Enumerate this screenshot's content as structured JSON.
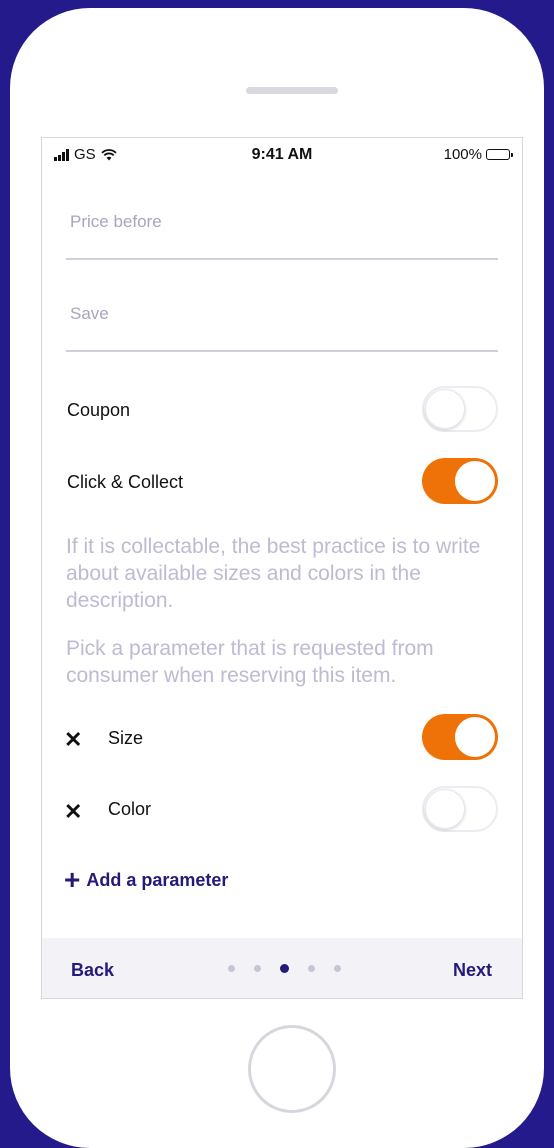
{
  "status_bar": {
    "carrier": "GS",
    "time": "9:41 AM",
    "battery": "100%"
  },
  "form": {
    "price_before": {
      "placeholder": "Price before",
      "value": ""
    },
    "save": {
      "placeholder": "Save",
      "value": ""
    },
    "coupon": {
      "label": "Coupon",
      "enabled": false
    },
    "click_collect": {
      "label": "Click & Collect",
      "enabled": true
    },
    "hint_collectable": "If it is collectable, the best practice is to write about available sizes and colors in the description.",
    "hint_parameter": "Pick a parameter that is requested from consumer when reserving this item.",
    "parameters": [
      {
        "label": "Size",
        "enabled": true
      },
      {
        "label": "Color",
        "enabled": false
      }
    ],
    "add_parameter": "Add a parameter"
  },
  "footer": {
    "back": "Back",
    "next": "Next",
    "page_count": 5,
    "current_page": 3
  },
  "colors": {
    "background": "#241a8c",
    "accent": "#ef7209",
    "brand": "#231a7a"
  },
  "icons": {
    "remove": "close-icon",
    "add": "plus-icon"
  }
}
